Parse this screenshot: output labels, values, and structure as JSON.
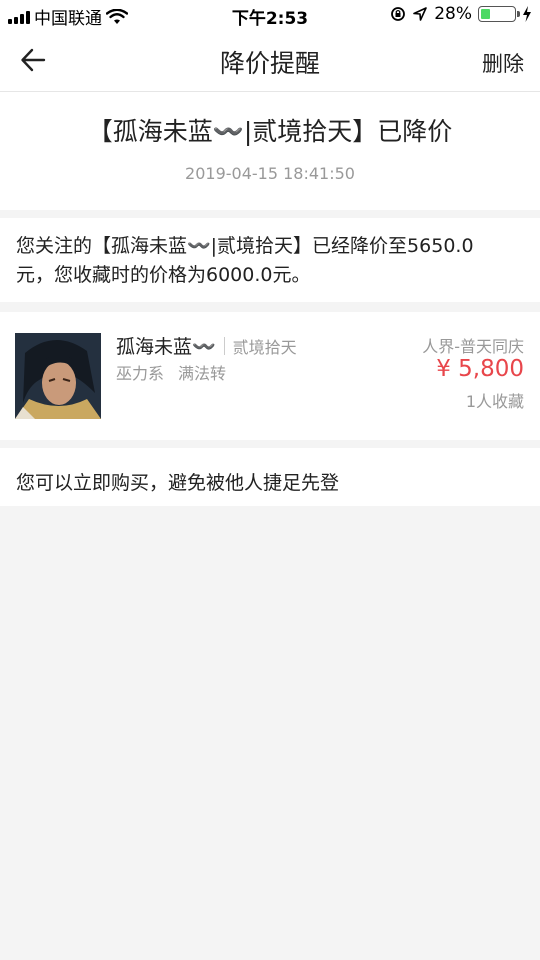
{
  "status_bar": {
    "carrier": "中国联通",
    "time": "下午2:53",
    "battery_percent": "28%",
    "battery_level": 0.28
  },
  "nav": {
    "title": "降价提醒",
    "delete_label": "删除"
  },
  "message": {
    "title": "【孤海未蓝〰️|贰境拾天】已降价",
    "timestamp": "2019-04-15 18:41:50",
    "body": "您关注的【孤海未蓝〰️|贰境拾天】已经降价至5650.0元，您收藏时的价格为6000.0元。"
  },
  "product": {
    "name": "孤海未蓝〰️",
    "server": "贰境拾天",
    "tag1": "巫力系",
    "tag2": "满法转",
    "region": "人界-普天同庆",
    "price": "¥ 5,800",
    "favorites": "1人收藏"
  },
  "hint": {
    "text": "您可以立即购买，避免被他人捷足先登"
  },
  "colors": {
    "price": "#e8464b",
    "battery": "#4cd964",
    "background": "#f4f4f4"
  },
  "icons": {
    "back": "arrow-left-icon",
    "wifi": "wifi-icon",
    "location": "location-arrow-icon",
    "rotation_lock": "rotation-lock-icon",
    "charging": "lightning-icon"
  }
}
